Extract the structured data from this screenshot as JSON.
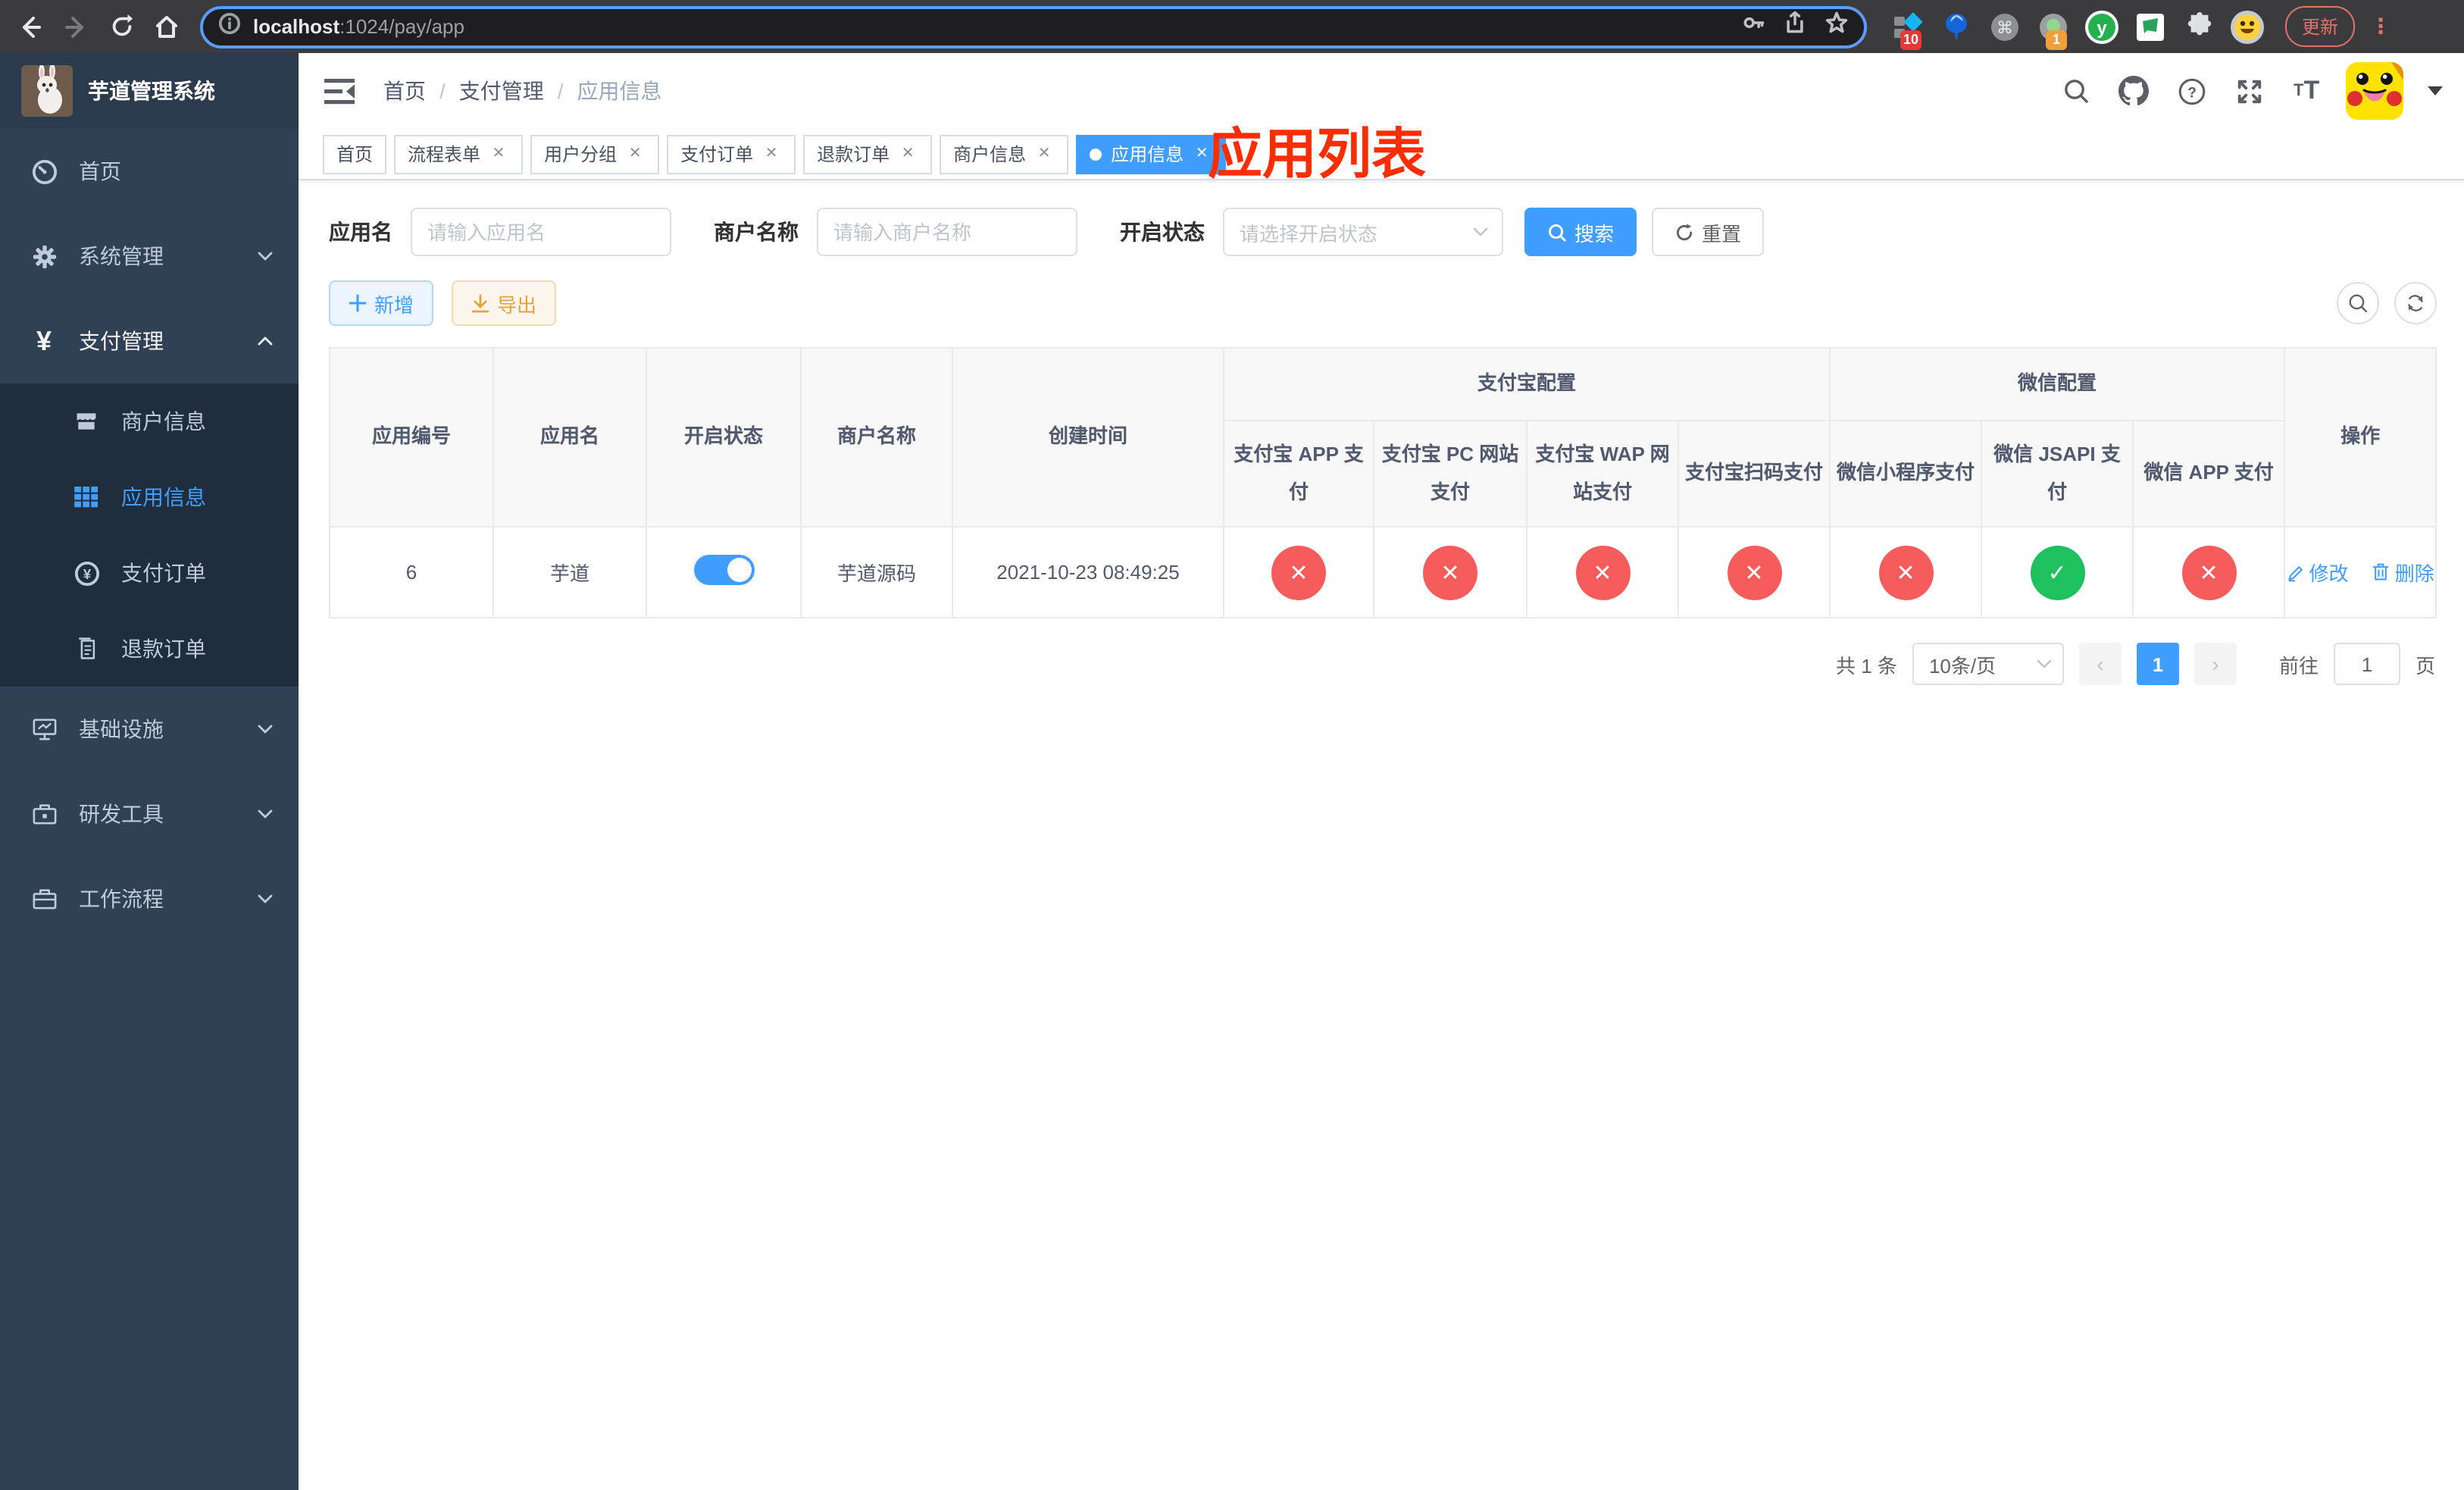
{
  "colors": {
    "accent": "#409eff",
    "success": "#1fc15f",
    "danger": "#f75c5c",
    "warning": "#e6a23c",
    "overlay": "#fe2d00"
  },
  "browser": {
    "url_host": "localhost",
    "url_rest": ":1024/pay/app",
    "ext_badge_counter": "10",
    "ext_badge_one": "1",
    "update_label": "更新"
  },
  "sidebar": {
    "title": "芋道管理系统",
    "items": [
      {
        "label": "首页"
      },
      {
        "label": "系统管理"
      },
      {
        "label": "支付管理"
      },
      {
        "label": "商户信息"
      },
      {
        "label": "应用信息"
      },
      {
        "label": "支付订单"
      },
      {
        "label": "退款订单"
      },
      {
        "label": "基础设施"
      },
      {
        "label": "研发工具"
      },
      {
        "label": "工作流程"
      }
    ]
  },
  "header": {
    "breadcrumb": [
      "首页",
      "支付管理",
      "应用信息"
    ],
    "separator": "/",
    "overlay_title": "应用列表"
  },
  "tabs": [
    {
      "label": "首页",
      "closable": false,
      "active": false
    },
    {
      "label": "流程表单",
      "closable": true,
      "active": false
    },
    {
      "label": "用户分组",
      "closable": true,
      "active": false
    },
    {
      "label": "支付订单",
      "closable": true,
      "active": false
    },
    {
      "label": "退款订单",
      "closable": true,
      "active": false
    },
    {
      "label": "商户信息",
      "closable": true,
      "active": false
    },
    {
      "label": "应用信息",
      "closable": true,
      "active": true
    }
  ],
  "filters": {
    "app_name_label": "应用名",
    "app_name_placeholder": "请输入应用名",
    "merchant_label": "商户名称",
    "merchant_placeholder": "请输入商户名称",
    "status_label": "开启状态",
    "status_placeholder": "请选择开启状态",
    "search_label": "搜索",
    "reset_label": "重置"
  },
  "toolbar": {
    "add_label": "新增",
    "export_label": "导出"
  },
  "table": {
    "simple_headers": [
      "应用编号",
      "应用名",
      "开启状态",
      "商户名称",
      "创建时间"
    ],
    "group_headers": [
      {
        "label": "支付宝配置",
        "children": [
          "支付宝 APP 支付",
          "支付宝 PC 网站支付",
          "支付宝 WAP 网站支付",
          "支付宝扫码支付"
        ]
      },
      {
        "label": "微信配置",
        "children": [
          "微信小程序支付",
          "微信 JSAPI 支付",
          "微信 APP 支付"
        ]
      }
    ],
    "action_header": "操作",
    "row": {
      "id": "6",
      "name": "芋道",
      "enabled": true,
      "merchant": "芋道源码",
      "created": "2021-10-23 08:49:25",
      "statuses": [
        "no",
        "no",
        "no",
        "no",
        "no",
        "yes",
        "no"
      ],
      "edit_label": "修改",
      "delete_label": "删除"
    }
  },
  "pagination": {
    "total_text": "共 1 条",
    "page_size_text": "10条/页",
    "current_page": "1",
    "goto_label": "前往",
    "goto_value": "1",
    "goto_suffix": "页"
  }
}
